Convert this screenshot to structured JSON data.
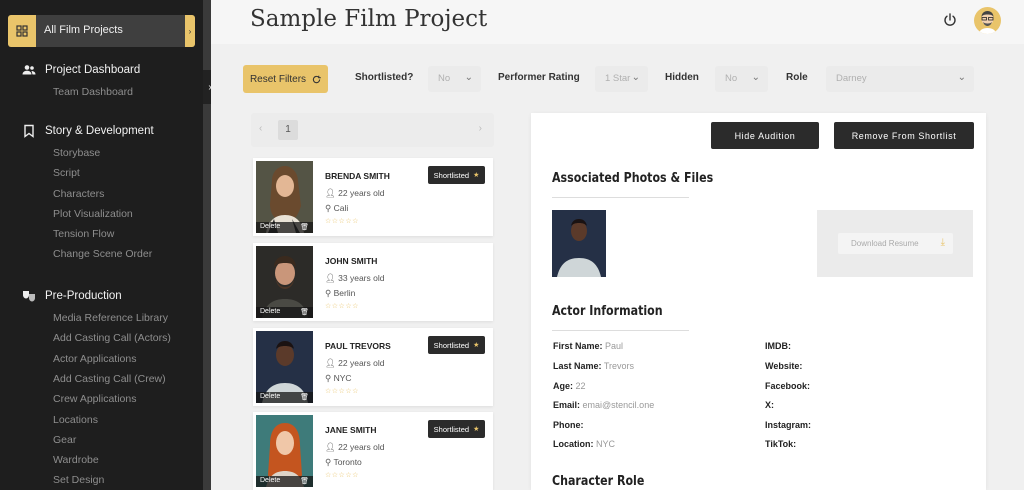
{
  "sidebar": {
    "active": "All Film Projects",
    "sections": [
      {
        "label": "Project Dashboard",
        "items": [
          "Team Dashboard"
        ]
      },
      {
        "label": "Story & Development",
        "items": [
          "Storybase",
          "Script",
          "Characters",
          "Plot Visualization",
          "Tension Flow",
          "Change Scene Order"
        ]
      },
      {
        "label": "Pre-Production",
        "items": [
          "Media Reference Library",
          "Add Casting Call (Actors)",
          "Actor Applications",
          "Add Casting Call (Crew)",
          "Crew Applications",
          "Locations",
          "Gear",
          "Wardrobe",
          "Set Design"
        ]
      }
    ]
  },
  "header": {
    "title": "Sample Film Project"
  },
  "filters": {
    "reset_label": "Reset Filters",
    "shortlisted_label": "Shortlisted?",
    "shortlisted_value": "No",
    "rating_label": "Performer Rating",
    "rating_value": "1 Star",
    "hidden_label": "Hidden",
    "hidden_value": "No",
    "role_label": "Role",
    "role_value": "Darney"
  },
  "pager": {
    "prev": "‹",
    "page": "1",
    "next": "›"
  },
  "cards": [
    {
      "name": "BRENDA SMITH",
      "age": "22 years old",
      "location": "Cali",
      "shortlisted": true
    },
    {
      "name": "JOHN SMITH",
      "age": "33 years old",
      "location": "Berlin",
      "shortlisted": false
    },
    {
      "name": "PAUL TREVORS",
      "age": "22 years old",
      "location": "NYC",
      "shortlisted": true
    },
    {
      "name": "JANE SMITH",
      "age": "22 years old",
      "location": "Toronto",
      "shortlisted": true
    }
  ],
  "card_labels": {
    "delete": "Delete",
    "shortlisted": "Shortlisted",
    "stars": "☆☆☆☆☆"
  },
  "detail": {
    "hide_button": "Hide Audition",
    "remove_button": "Remove From Shortlist",
    "photos_title": "Associated Photos & Files",
    "download_resume": "Download Resume",
    "actor_info_title": "Actor Information",
    "character_role_title": "Character Role",
    "fields_left": [
      {
        "label": "First Name:",
        "value": "Paul"
      },
      {
        "label": "Last Name:",
        "value": "Trevors"
      },
      {
        "label": "Age:",
        "value": "22"
      },
      {
        "label": "Email:",
        "value": "emai@stencil.one"
      },
      {
        "label": "Phone:",
        "value": ""
      },
      {
        "label": "Location:",
        "value": "NYC"
      }
    ],
    "fields_right": [
      {
        "label": "IMDB:",
        "value": ""
      },
      {
        "label": "Website:",
        "value": ""
      },
      {
        "label": "Facebook:",
        "value": ""
      },
      {
        "label": "X:",
        "value": ""
      },
      {
        "label": "Instagram:",
        "value": ""
      },
      {
        "label": "TikTok:",
        "value": ""
      }
    ]
  },
  "colors": {
    "accent": "#e9c46a",
    "sidebar_bg": "#1e1e1e",
    "dark_button": "#2b2b2b"
  }
}
